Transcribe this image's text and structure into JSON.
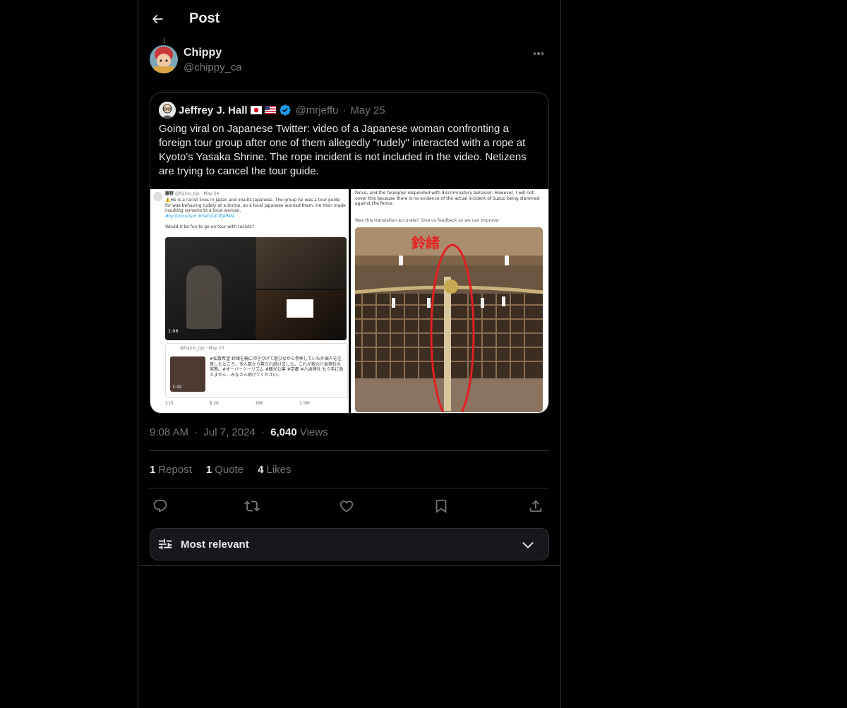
{
  "header": {
    "title": "Post"
  },
  "author": {
    "name": "Chippy",
    "handle": "@chippy_ca"
  },
  "quote": {
    "name": "Jeffrey J. Hall",
    "handle": "@mrjeffu",
    "separator": "·",
    "date": "May 25",
    "text": "Going viral on Japanese Twitter: video of a Japanese woman confronting a foreign tour group after one of them allegedly \"rudely\" interacted with a rope at Kyoto's Yasaka Shrine. The rope incident is not included in the video. Netizens are trying to cancel the tour guide.",
    "media": {
      "left": {
        "user": "藤野",
        "handle_date": "@fujino_ojo · May 24",
        "text": "⚠️He is a racist lives in Japan and insults Japanese. The group he was a tour guide for was behaving rudely at a shrine, so a local japanese warned them. He then made insulting remarks to a local woman.",
        "hashtags": "#kyototourism #GetOutOfJAPAN",
        "question": "Would it be fun to go on tour with racists?",
        "video_time": "1:06",
        "nested_handle_date": "@fujino_ojo · May 23",
        "nested_text": "#拡散希望 鈴緒を柵に叩きつけて遊びながら参拝していた外国人を注意したところ、多人数から罵られ続けました。これが我の八坂神社の実態。#オーバーツーリズム #観光公害 #京都 #八坂神社 もう手に負えません…みなさん助けてください。",
        "nested_video_time": "1:32",
        "stats": [
          "215",
          "8.2K",
          "16K",
          "1.5M"
        ]
      },
      "right": {
        "text": "fence, and the foreigner responded with discriminatory behavior. However, I will not cover this because there is no evidence of the actual incident of Suzuo being slammed against the fence.",
        "feedback": "Was this translation accurate? Give us feedback so we can improve:",
        "label": "鈴緒"
      }
    }
  },
  "timestamp": {
    "time": "9:08 AM",
    "date": "Jul 7, 2024",
    "views_count": "6,040",
    "views_label": "Views",
    "separator": "·"
  },
  "stats": [
    {
      "count": "1",
      "label": "Repost"
    },
    {
      "count": "1",
      "label": "Quote"
    },
    {
      "count": "4",
      "label": "Likes"
    }
  ],
  "sort": {
    "label": "Most relevant"
  },
  "icons": [
    "back-arrow-icon",
    "more-icon",
    "verified-icon",
    "reply-icon",
    "repost-icon",
    "like-icon",
    "bookmark-icon",
    "share-icon",
    "filter-icon",
    "chevron-down-icon"
  ],
  "colors": {
    "background": "#000000",
    "text": "#e7e9ea",
    "secondary": "#71767b",
    "border": "#2f3336",
    "verified": "#1d9bf0"
  }
}
